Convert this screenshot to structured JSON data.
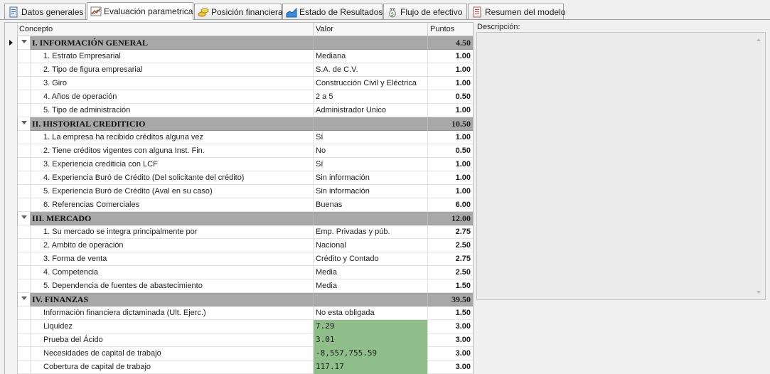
{
  "tabs": [
    {
      "label": "Datos generales",
      "icon": "document-icon",
      "active": false
    },
    {
      "label": "Evaluación parametrica",
      "icon": "chart-icon",
      "active": true
    },
    {
      "label": "Posición financiera",
      "icon": "coins-icon",
      "active": false
    },
    {
      "label": "Estado de Resultados",
      "icon": "area-chart-icon",
      "active": false
    },
    {
      "label": "Flujo de efectivo",
      "icon": "money-bag-icon",
      "active": false
    },
    {
      "label": "Resumen del modelo",
      "icon": "report-icon",
      "active": false
    }
  ],
  "grid": {
    "headers": {
      "concept": "Concepto",
      "valor": "Valor",
      "puntos": "Puntos"
    },
    "groups": [
      {
        "title": "I. INFORMACIÓN GENERAL",
        "puntos": "4.50",
        "rows": [
          {
            "concept": "1. Estrato Empresarial",
            "valor": "Mediana",
            "puntos": "1.00"
          },
          {
            "concept": "2. Tipo de figura empresarial",
            "valor": "S.A. de C.V.",
            "puntos": "1.00"
          },
          {
            "concept": "3. Giro",
            "valor": "Construcción Civil y Eléctrica",
            "puntos": "1.00"
          },
          {
            "concept": "4. Años de operación",
            "valor": "2 a 5",
            "puntos": "0.50"
          },
          {
            "concept": "5. Tipo de administración",
            "valor": "Administrador Unico",
            "puntos": "1.00"
          }
        ]
      },
      {
        "title": "II. HISTORIAL CREDITICIO",
        "puntos": "10.50",
        "rows": [
          {
            "concept": "1. La empresa ha recibido créditos alguna vez",
            "valor": "Sí",
            "puntos": "1.00"
          },
          {
            "concept": "2. Tiene créditos vigentes con alguna Inst. Fin.",
            "valor": "No",
            "puntos": "0.50"
          },
          {
            "concept": "3. Experiencia crediticia con LCF",
            "valor": "Sí",
            "puntos": "1.00"
          },
          {
            "concept": "4. Experiencia Buró de Crédito (Del solicitante del crédito)",
            "valor": "Sin información",
            "puntos": "1.00"
          },
          {
            "concept": "5. Experiencia Buró de Crédito (Aval en su caso)",
            "valor": "Sin información",
            "puntos": "1.00"
          },
          {
            "concept": "6. Referencias Comerciales",
            "valor": "Buenas",
            "puntos": "6.00"
          }
        ]
      },
      {
        "title": "III. MERCADO",
        "puntos": "12.00",
        "rows": [
          {
            "concept": "1. Su mercado se integra principalmente por",
            "valor": "Emp. Privadas y púb.",
            "puntos": "2.75"
          },
          {
            "concept": "2. Ambito de operación",
            "valor": "Nacional",
            "puntos": "2.50"
          },
          {
            "concept": "3. Forma de venta",
            "valor": "Crédito y Contado",
            "puntos": "2.75"
          },
          {
            "concept": "4. Competencia",
            "valor": "Media",
            "puntos": "2.50"
          },
          {
            "concept": "5. Dependencia de fuentes de abastecimiento",
            "valor": "Media",
            "puntos": "1.50"
          }
        ]
      },
      {
        "title": "IV. FINANZAS",
        "puntos": "39.50",
        "rows": [
          {
            "concept": "Información financiera dictaminada (Ult. Ejerc.)",
            "valor": "No esta obligada",
            "puntos": "1.50",
            "highlight": false
          },
          {
            "concept": "Liquidez",
            "valor": "7.29",
            "puntos": "3.00",
            "highlight": true
          },
          {
            "concept": "Prueba del Ácido",
            "valor": "3.01",
            "puntos": "3.00",
            "highlight": true
          },
          {
            "concept": "Necesidades de capital de trabajo",
            "valor": "-8,557,755.59",
            "puntos": "3.00",
            "highlight": true
          },
          {
            "concept": "Cobertura de capital de trabajo",
            "valor": "117.17",
            "puntos": "3.00",
            "highlight": true
          }
        ]
      }
    ]
  },
  "description": {
    "label": "Descripción:",
    "value": ""
  },
  "colors": {
    "group_bar": "#a8a8a8",
    "highlight": "#8fbe8a"
  }
}
